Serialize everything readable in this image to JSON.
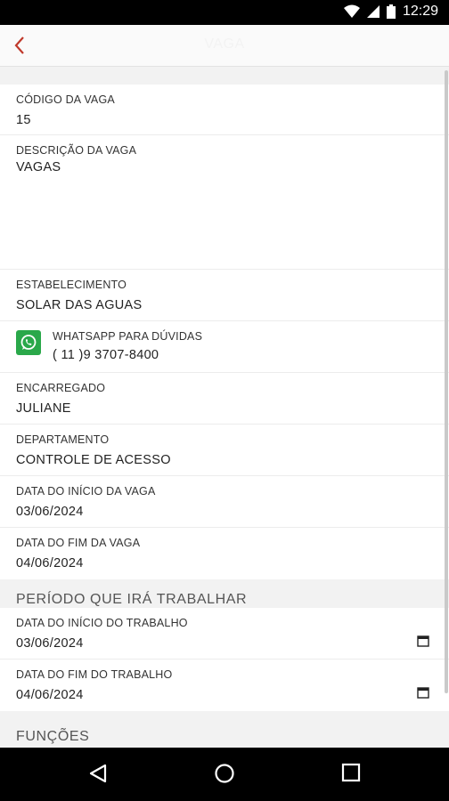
{
  "status_bar": {
    "time": "12:29"
  },
  "app_bar": {
    "title": "VAGA"
  },
  "details": {
    "job_code": {
      "label": "CÓDIGO DA VAGA",
      "value": "15"
    },
    "job_description": {
      "label": "DESCRIÇÃO DA VAGA",
      "value": "VAGAS"
    },
    "establishment": {
      "label": "ESTABELECIMENTO",
      "value": "SOLAR DAS AGUAS"
    },
    "whatsapp": {
      "label": "WHATSAPP PARA DÚVIDAS",
      "value": "( 11 )9 3707-8400"
    },
    "manager": {
      "label": "ENCARREGADO",
      "value": "JULIANE"
    },
    "department": {
      "label": "DEPARTAMENTO",
      "value": "CONTROLE DE ACESSO"
    },
    "job_start": {
      "label": "DATA DO INÍCIO DA VAGA",
      "value": "03/06/2024"
    },
    "job_end": {
      "label": "DATA DO FIM DA VAGA",
      "value": "04/06/2024"
    }
  },
  "work_period": {
    "title": "PERÍODO QUE IRÁ TRABALHAR",
    "work_start": {
      "label": "DATA DO INÍCIO DO TRABALHO",
      "value": "03/06/2024"
    },
    "work_end": {
      "label": "DATA DO FIM DO TRABALHO",
      "value": "04/06/2024"
    }
  },
  "functions": {
    "title": "FUNÇÕES"
  },
  "colors": {
    "accent": "#c0392b",
    "whatsapp": "#2aa84a"
  },
  "icons": [
    "wifi-icon",
    "signal-icon",
    "battery-icon",
    "back-arrow-icon",
    "whatsapp-icon",
    "calendar-icon",
    "nav-back-icon",
    "nav-home-icon",
    "nav-recents-icon"
  ]
}
